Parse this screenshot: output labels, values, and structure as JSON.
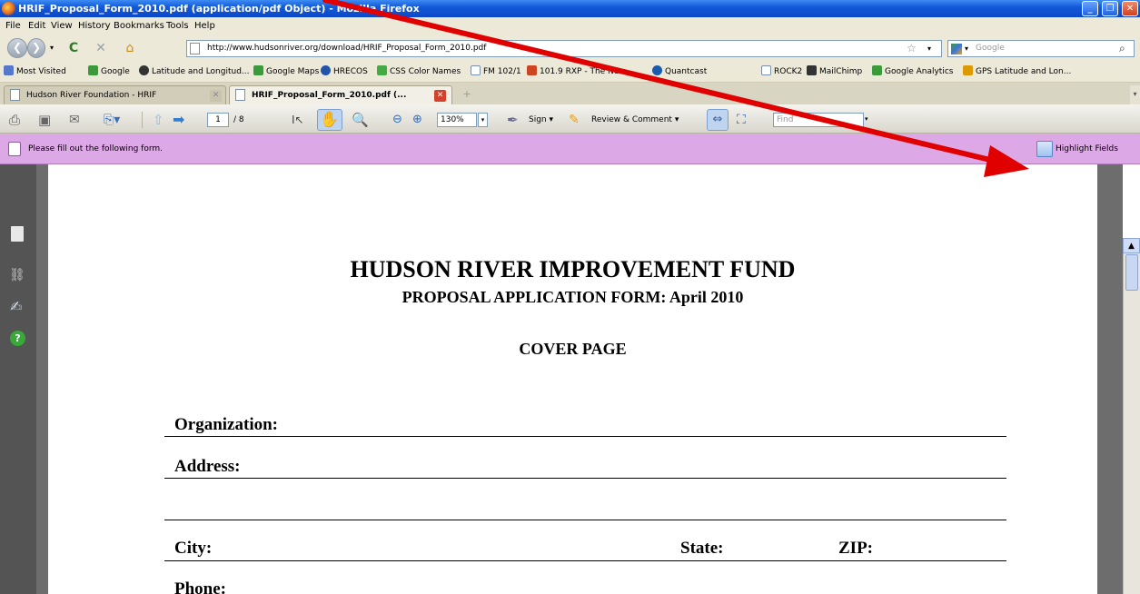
{
  "window": {
    "title": "HRIF_Proposal_Form_2010.pdf (application/pdf Object) - Mozilla Firefox"
  },
  "menu": [
    "File",
    "Edit",
    "View",
    "History",
    "Bookmarks",
    "Tools",
    "Help"
  ],
  "nav": {
    "url": "http://www.hudsonriver.org/download/HRIF_Proposal_Form_2010.pdf",
    "search_placeholder": "Google"
  },
  "bookmarks": [
    {
      "label": "Most Visited",
      "icon": "most-visited-icon",
      "color": "#5577cc"
    },
    {
      "label": "Google",
      "icon": "google-icon",
      "color": "#3a9b3a"
    },
    {
      "label": "Latitude and Longitud...",
      "icon": "globe-icon",
      "color": "#333333"
    },
    {
      "label": "Google Maps",
      "icon": "google-maps-icon",
      "color": "#3a9b3a"
    },
    {
      "label": "HRECOS",
      "icon": "hrecos-icon",
      "color": "#2255aa"
    },
    {
      "label": "CSS Color Names",
      "icon": "css-icon",
      "color": "#44aa44"
    },
    {
      "label": "FM 102/1",
      "icon": "page-icon",
      "color": "#ffffff"
    },
    {
      "label": "101.9 RXP - The New ...",
      "icon": "rxp-icon",
      "color": "#cc4422"
    },
    {
      "label": "Quantcast",
      "icon": "quantcast-icon",
      "color": "#1a5ab0"
    },
    {
      "label": "ROCK2",
      "icon": "page-icon",
      "color": "#ffffff"
    },
    {
      "label": "MailChimp",
      "icon": "mailchimp-icon",
      "color": "#333333"
    },
    {
      "label": "Google Analytics",
      "icon": "google-analytics-icon",
      "color": "#3a9b3a"
    },
    {
      "label": "GPS Latitude and Lon...",
      "icon": "csg-icon",
      "color": "#dd9900"
    }
  ],
  "tabs": [
    {
      "label": "Hudson River Foundation - HRIF",
      "active": false
    },
    {
      "label": "HRIF_Proposal_Form_2010.pdf (...",
      "active": true
    }
  ],
  "pdf_toolbar": {
    "page_current": "1",
    "page_total": "/ 8",
    "zoom": "130%",
    "sign_label": "Sign",
    "review_label": "Review & Comment",
    "find_placeholder": "Find"
  },
  "form_bar": {
    "message": "Please fill out the following form.",
    "highlight_label": "Highlight Fields"
  },
  "document": {
    "title": "HUDSON RIVER IMPROVEMENT FUND",
    "subtitle": "PROPOSAL APPLICATION FORM: April 2010",
    "section": "COVER PAGE",
    "fields": {
      "organization": "Organization:",
      "address": "Address:",
      "city": "City:",
      "state": "State:",
      "zip": "ZIP:",
      "phone": "Phone:"
    }
  },
  "colors": {
    "annotation_arrow": "#e00000",
    "form_bar": "#dda8e6"
  }
}
